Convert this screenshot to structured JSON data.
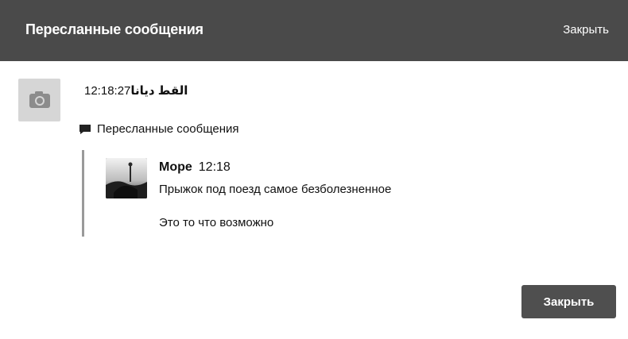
{
  "header": {
    "title": "Пересланные сообщения",
    "close_label": "Закрыть"
  },
  "message": {
    "sender": "القط ديانا",
    "time": "12:18:27",
    "avatar_icon": "camera-icon"
  },
  "forwarded": {
    "label": "Пересланные сообщения",
    "icon": "speech-bubble-icon",
    "author": "Море",
    "time": "12:18",
    "lines": [
      "Прыжок под поезд самое безболезненное",
      "Это то что возможно"
    ]
  },
  "footer": {
    "close_button_label": "Закрыть"
  },
  "colors": {
    "header_bg": "#4a4a4a",
    "button_bg": "#4f4f4f",
    "quote_bar": "#9a9a9a",
    "avatar_bg": "#d6d6d6"
  }
}
